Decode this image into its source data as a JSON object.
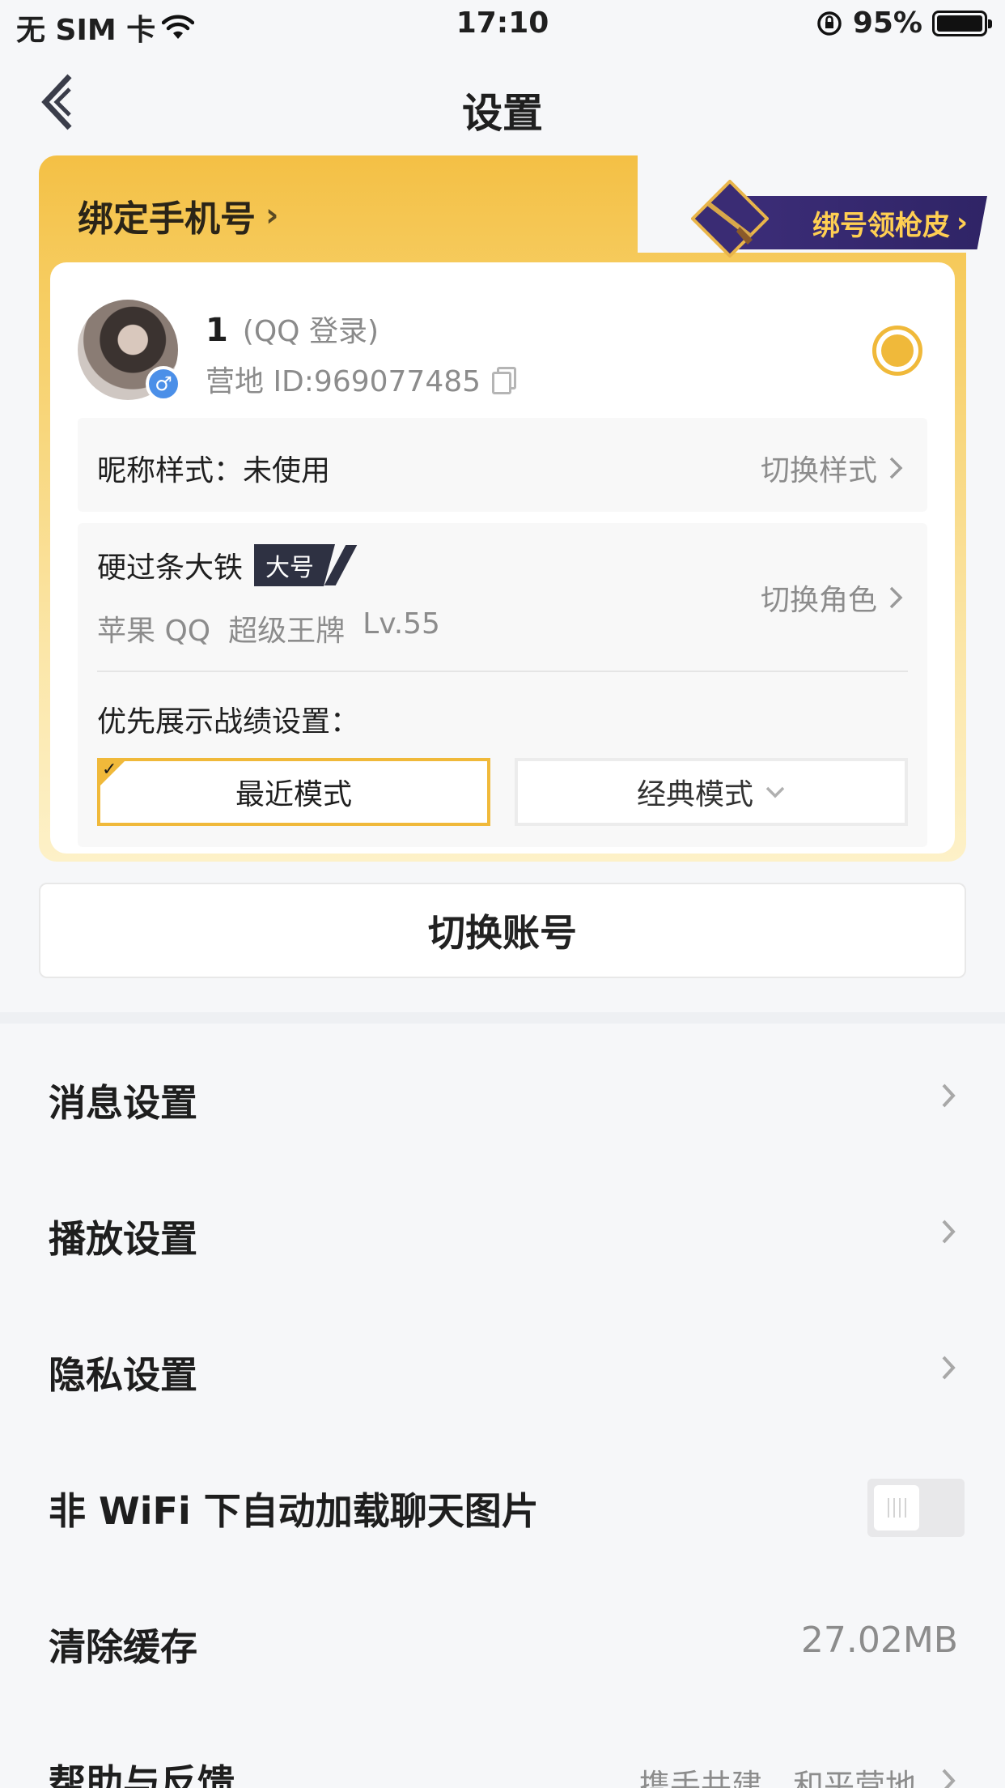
{
  "status_bar": {
    "carrier": "无 SIM 卡",
    "time": "17:10",
    "battery": "95%",
    "battery_level": 0.95
  },
  "nav": {
    "title": "设置"
  },
  "account_card": {
    "bind_phone": "绑定手机号",
    "skin_promo": "绑号领枪皮",
    "user_name": "1",
    "login_type": "(QQ 登录)",
    "camp_id": "营地 ID:969077485",
    "nickname_style_label": "昵称样式：未使用",
    "switch_style": "切换样式",
    "role_name": "硬过条大铁",
    "role_tag": "大号",
    "role_platform": "苹果 QQ",
    "role_rank": "超级王牌",
    "role_level": "Lv.55",
    "switch_role": "切换角色",
    "priority_label": "优先展示战绩设置：",
    "mode_recent": "最近模式",
    "mode_classic": "经典模式",
    "accent_color": "#f0b93a"
  },
  "switch_account": "切换账号",
  "settings": [
    {
      "label": "消息设置"
    },
    {
      "label": "播放设置"
    },
    {
      "label": "隐私设置"
    },
    {
      "label": "非 WiFi 下自动加载聊天图片",
      "toggle": false
    },
    {
      "label": "清除缓存",
      "value": "27.02MB"
    },
    {
      "label": "帮助与反馈",
      "value": "携手共建，和平营地"
    }
  ]
}
